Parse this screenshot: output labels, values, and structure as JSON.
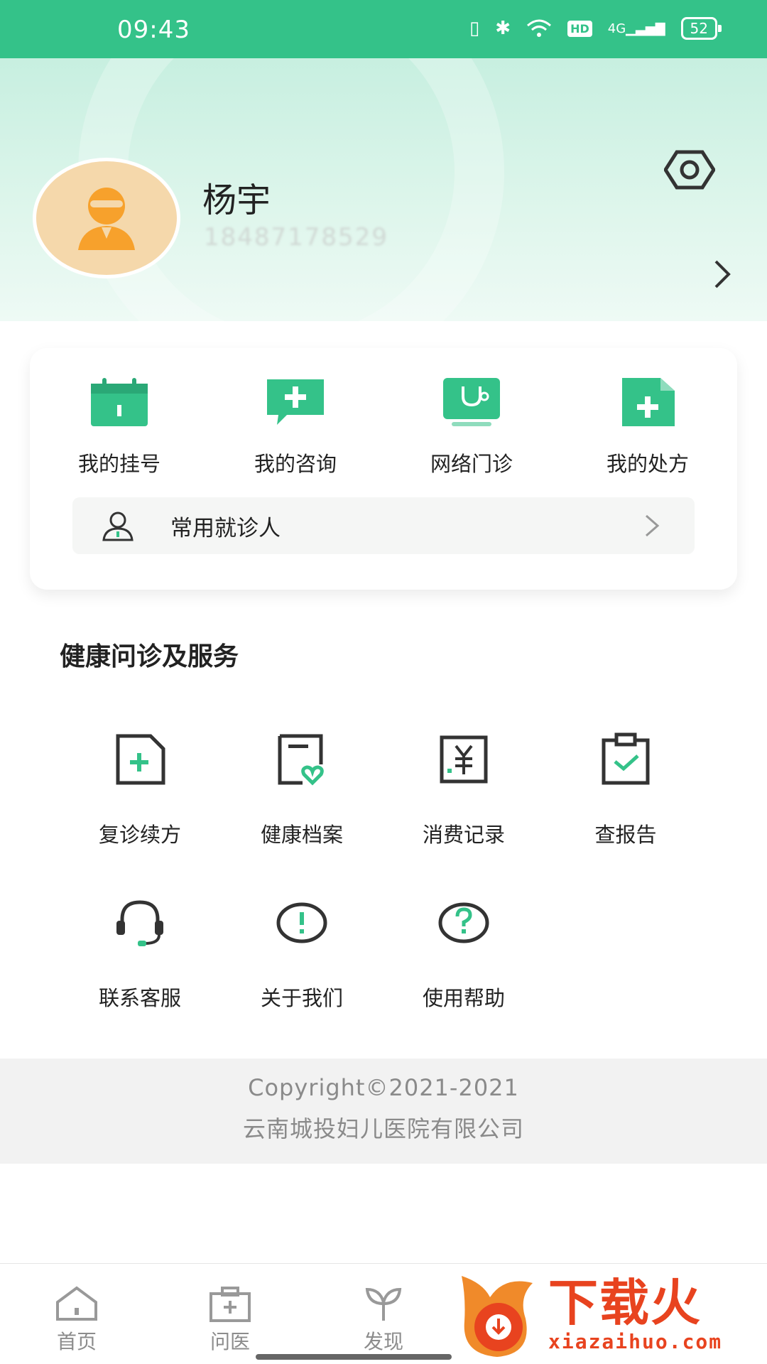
{
  "status_bar": {
    "time": "09:43",
    "network": "4G",
    "hd": "HD",
    "battery": "52"
  },
  "profile": {
    "name": "杨宇",
    "phone": "18487178529"
  },
  "quick_actions": [
    {
      "label": "我的挂号",
      "icon": "calendar-icon"
    },
    {
      "label": "我的咨询",
      "icon": "chat-plus-icon"
    },
    {
      "label": "网络门诊",
      "icon": "stethoscope-monitor-icon"
    },
    {
      "label": "我的处方",
      "icon": "prescription-icon"
    }
  ],
  "patients_row": {
    "label": "常用就诊人",
    "icon": "person-icon"
  },
  "services": {
    "title": "健康问诊及服务",
    "items": [
      {
        "label": "复诊续方",
        "icon": "document-plus-icon"
      },
      {
        "label": "健康档案",
        "icon": "health-record-icon"
      },
      {
        "label": "消费记录",
        "icon": "yuan-receipt-icon"
      },
      {
        "label": "查报告",
        "icon": "clipboard-check-icon"
      },
      {
        "label": "联系客服",
        "icon": "headset-icon"
      },
      {
        "label": "关于我们",
        "icon": "info-icon"
      },
      {
        "label": "使用帮助",
        "icon": "help-icon"
      }
    ]
  },
  "footer": {
    "copyright": "Copyright©2021-2021",
    "company": "云南城投妇儿医院有限公司"
  },
  "bottom_nav": [
    {
      "label": "首页",
      "icon": "home-icon"
    },
    {
      "label": "问医",
      "icon": "medical-kit-icon"
    },
    {
      "label": "发现",
      "icon": "sprout-icon"
    }
  ],
  "watermark": {
    "title": "下载火",
    "url": "xiazaihuo.com"
  },
  "colors": {
    "brand": "#34c289",
    "icon_dark": "#333333"
  }
}
